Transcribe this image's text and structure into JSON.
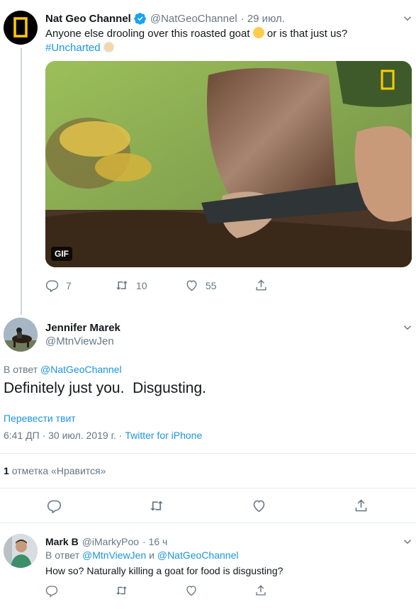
{
  "tweet1": {
    "display_name": "Nat Geo Channel",
    "handle": "@NatGeoChannel",
    "date": "· 29 июл.",
    "text_before_emoji": "Anyone else drooling over this roasted goat ",
    "text_after_emoji": " or is that just us?",
    "hashtag": "#Uncharted",
    "media_badge": "GIF",
    "replies": "7",
    "retweets": "10",
    "likes": "55"
  },
  "tweet2": {
    "display_name": "Jennifer Marek",
    "handle": "@MtnViewJen",
    "reply_prefix": "В ответ",
    "reply_to": "@NatGeoChannel",
    "text": "Definitely just you.  Disgusting.",
    "translate": "Перевести твит",
    "timestamp": "6:41 ДП · 30 июл. 2019 г. ·",
    "source": "Twitter for iPhone",
    "likes_count": "1",
    "likes_label": "отметка «Нравится»"
  },
  "tweet3": {
    "display_name": "Mark B",
    "handle": "@iMarkyPoo",
    "date": "· 16 ч",
    "reply_prefix": "В ответ",
    "reply_to_1": "@MtnViewJen",
    "reply_and": "и",
    "reply_to_2": "@NatGeoChannel",
    "text": "How so? Naturally killing a goat for food is disgusting?"
  },
  "colors": {
    "link": "#1b95e0",
    "secondary": "#657786",
    "natgeo_yellow": "#ffcc00",
    "verified": "#1da1f2"
  },
  "icons": [
    "verified-badge-icon",
    "reply-icon",
    "retweet-icon",
    "like-icon",
    "share-icon",
    "chevron-down-icon"
  ]
}
